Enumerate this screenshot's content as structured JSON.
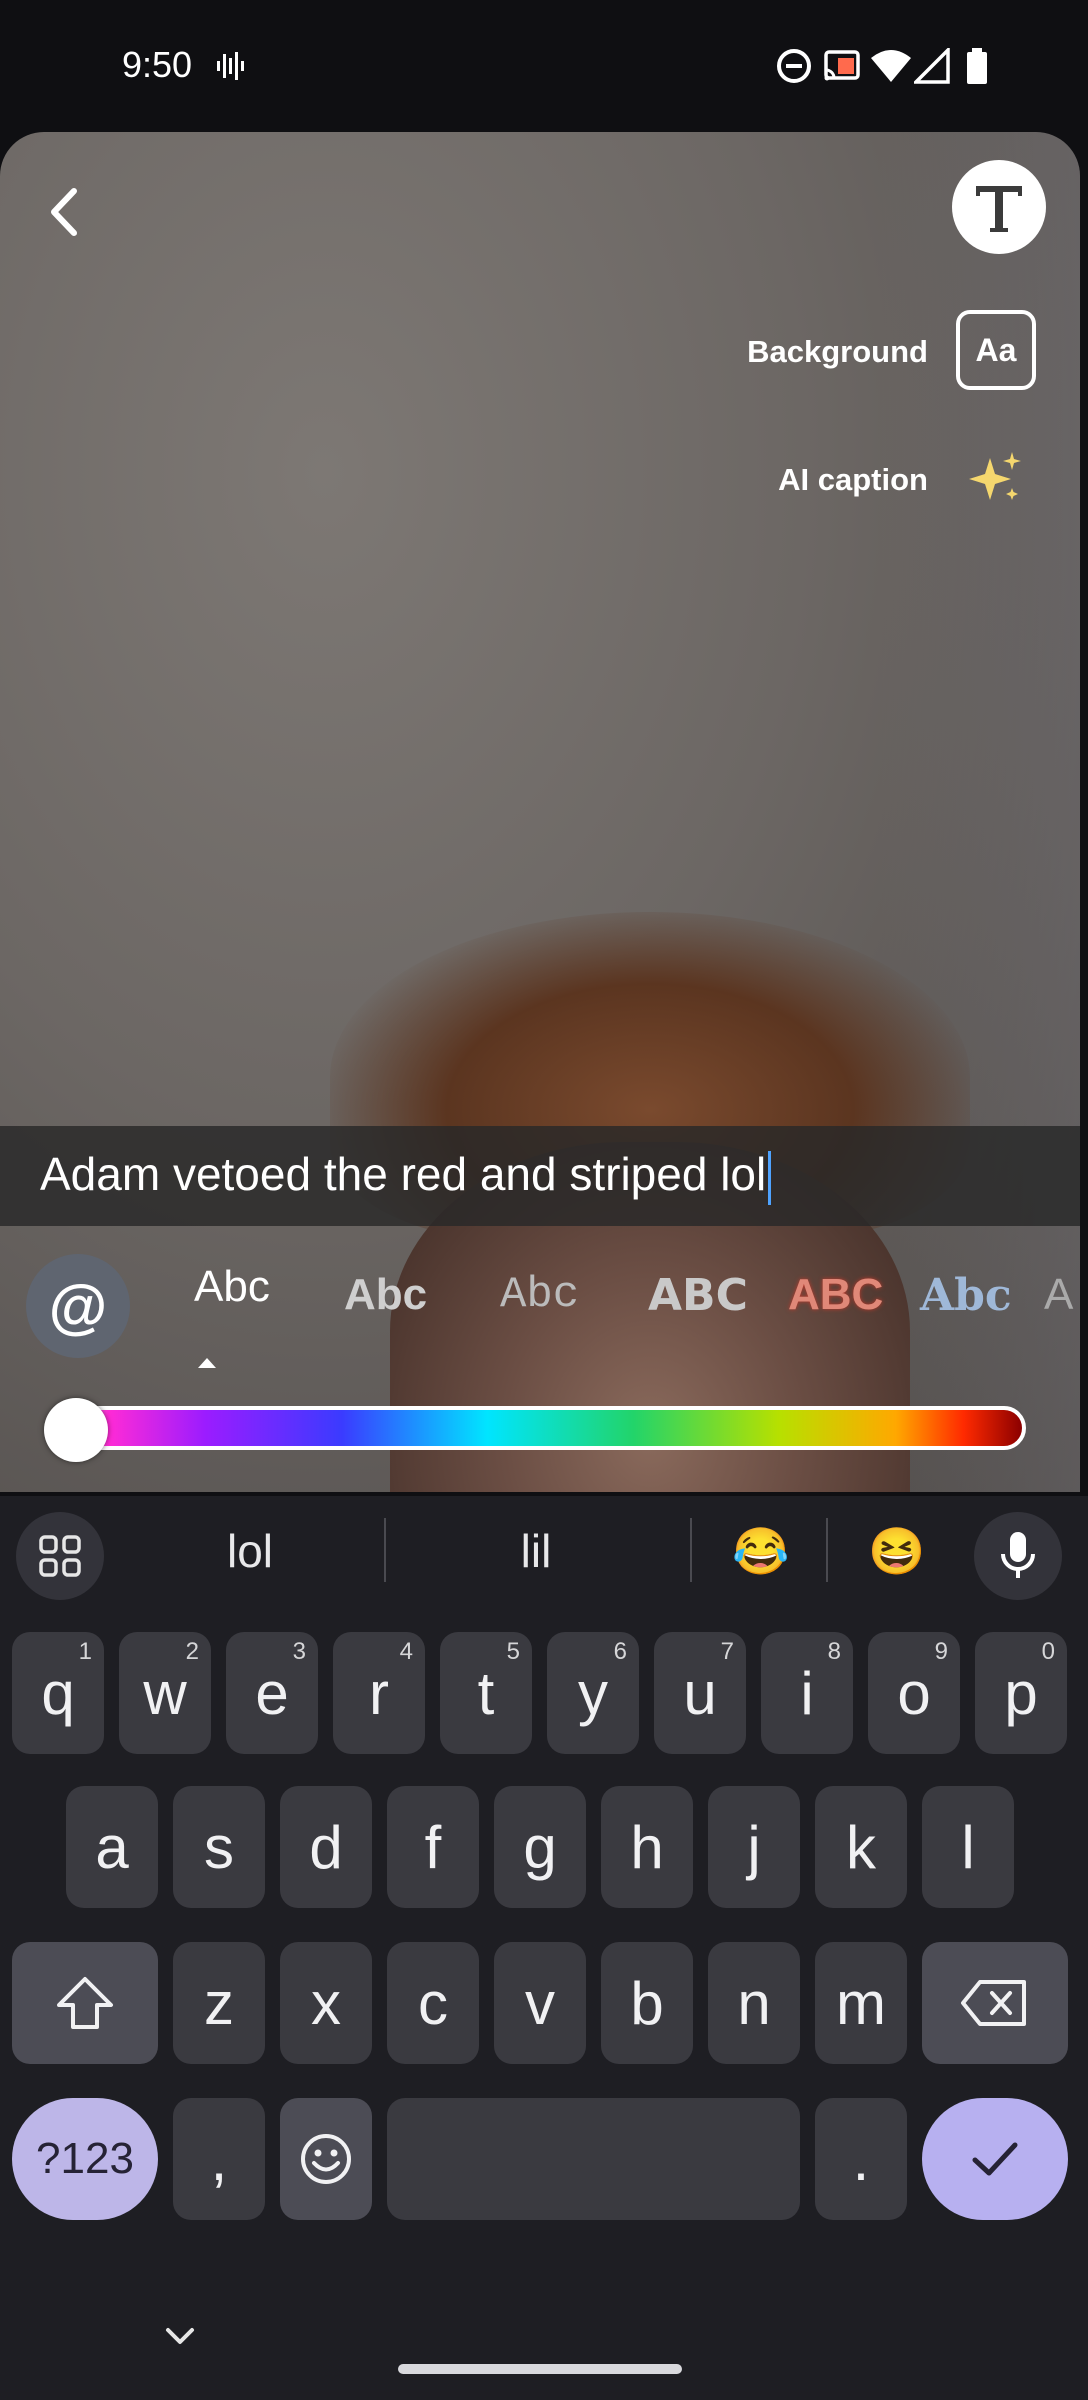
{
  "status_bar": {
    "time": "9:50"
  },
  "editor": {
    "background_label": "Background",
    "background_toggle": "Aa",
    "ai_caption_label": "AI caption",
    "caption_text": "Adam vetoed the red and striped lol"
  },
  "font_row": {
    "mention": "@",
    "fonts": [
      "Abc",
      "Abc",
      "Abc",
      "ABC",
      "ABC",
      "Abc",
      "A"
    ]
  },
  "color_picker": {
    "selected_color": "#ffffff",
    "gradient": [
      "#ffffff",
      "#ff2bd6",
      "#9b1cff",
      "#3b3bff",
      "#00e5ff",
      "#22d46a",
      "#b7e000",
      "#ffa800",
      "#ff2a00",
      "#8b0000"
    ]
  },
  "keyboard": {
    "suggestions": [
      "lol",
      "lil",
      "😂",
      "😆"
    ],
    "row1": [
      {
        "key": "q",
        "num": "1"
      },
      {
        "key": "w",
        "num": "2"
      },
      {
        "key": "e",
        "num": "3"
      },
      {
        "key": "r",
        "num": "4"
      },
      {
        "key": "t",
        "num": "5"
      },
      {
        "key": "y",
        "num": "6"
      },
      {
        "key": "u",
        "num": "7"
      },
      {
        "key": "i",
        "num": "8"
      },
      {
        "key": "o",
        "num": "9"
      },
      {
        "key": "p",
        "num": "0"
      }
    ],
    "row2": [
      "a",
      "s",
      "d",
      "f",
      "g",
      "h",
      "j",
      "k",
      "l"
    ],
    "row3": [
      "z",
      "x",
      "c",
      "v",
      "b",
      "n",
      "m"
    ],
    "symbols_label": "?123",
    "comma": ",",
    "period": "."
  }
}
